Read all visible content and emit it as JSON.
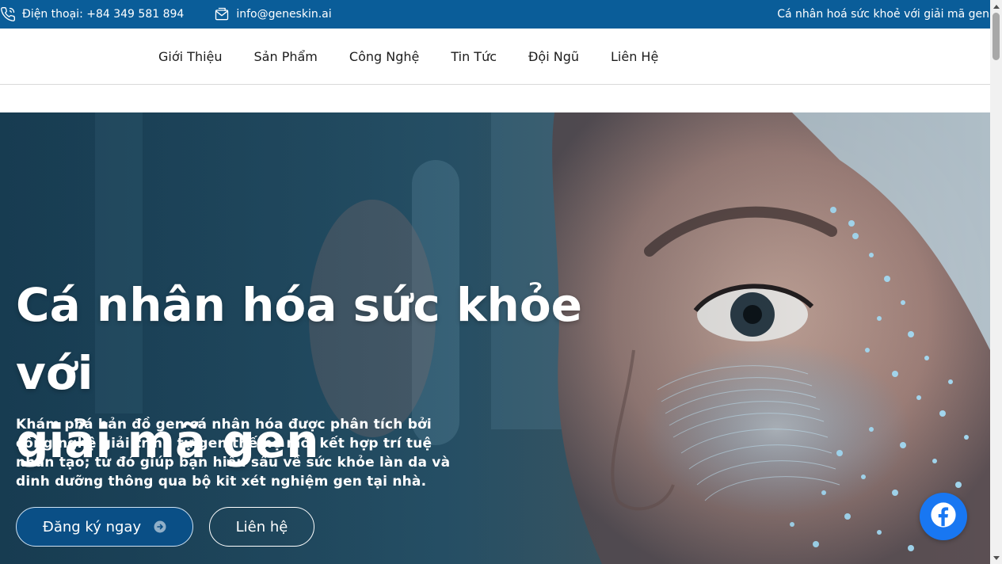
{
  "topbar": {
    "phone_text": "Điện thoại: +84 349 581 894",
    "email_text": "info@geneskin.ai",
    "tagline": "Cá nhân hoá sức khoẻ với giải mã gen",
    "icons": {
      "phone": "phone-icon",
      "email": "email-icon"
    },
    "background": "#0a5d99"
  },
  "nav": {
    "items": [
      {
        "label": "Giới Thiệu"
      },
      {
        "label": "Sản Phẩm"
      },
      {
        "label": "Công Nghệ"
      },
      {
        "label": "Tin Tức"
      },
      {
        "label": "Đội Ngũ"
      },
      {
        "label": "Liên Hệ"
      }
    ]
  },
  "hero": {
    "title_line1": "Cá nhân hóa sức khỏe với",
    "title_line2": "giải mã gen",
    "description": "Khám phá bản đồ gen cá nhân hóa được phân tích bởi công nghệ giải trình tự gen thế hệ mới kết hợp trí tuệ nhân tạo; từ đó giúp bạn hiểu sâu về sức khỏe làn da và dinh dưỡng thông qua bộ kit xét nghiệm gen tại nhà.",
    "primary_button": "Đăng ký ngay",
    "secondary_button": "Liên hệ",
    "primary_icon": "arrow-right-circle-icon"
  },
  "floating": {
    "facebook_icon": "facebook-icon",
    "color": "#1877f2"
  }
}
